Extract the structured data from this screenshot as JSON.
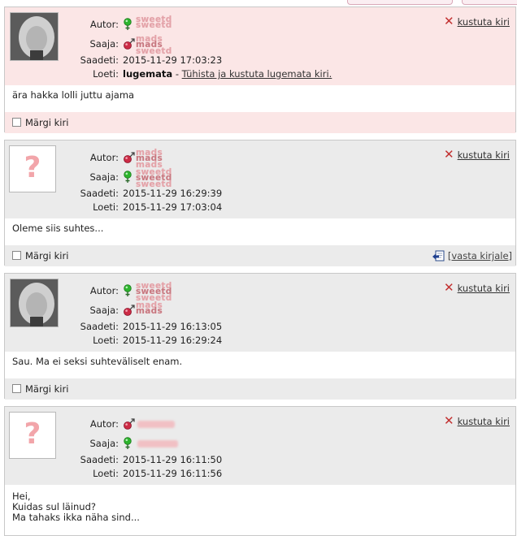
{
  "labels": {
    "author": "Autor:",
    "recipient": "Saaja:",
    "sent": "Saadeti:",
    "read": "Loeti:",
    "delete": "kustuta kiri",
    "mark": "Märgi kiri",
    "reply": "[vasta kirjale]",
    "question_mark": "?"
  },
  "nicknames": {
    "female": "sweetd",
    "male": "mads"
  },
  "messages": [
    {
      "author_gender": "female",
      "recipient_gender": "male",
      "sent": "2015-11-29 17:03:23",
      "read_status": "lugemata",
      "read_separator": " - ",
      "read_action": "Tühista ja kustuta lugemata kiri.",
      "body": "ära hakka lolli juttu ajama"
    },
    {
      "author_gender": "male",
      "recipient_gender": "female",
      "sent": "2015-11-29 16:29:39",
      "read": "2015-11-29 17:03:04",
      "body": "Oleme siis suhtes..."
    },
    {
      "author_gender": "female",
      "recipient_gender": "male",
      "sent": "2015-11-29 16:13:05",
      "read": "2015-11-29 16:29:24",
      "body": "Sau. Ma ei seksi suhteväliselt enam."
    },
    {
      "author_gender": "male",
      "recipient_gender": "female",
      "sent": "2015-11-29 16:11:50",
      "read": "2015-11-29 16:11:56",
      "body_lines": [
        "Hei,",
        "Kuidas sul läinud?",
        "Ma tahaks ikka näha sind..."
      ]
    }
  ],
  "colors": {
    "unread_bg": "#fbe6e6",
    "read_bg": "#ebebeb",
    "delete_x": "#c23030",
    "nickname": "#e3a2a8"
  }
}
